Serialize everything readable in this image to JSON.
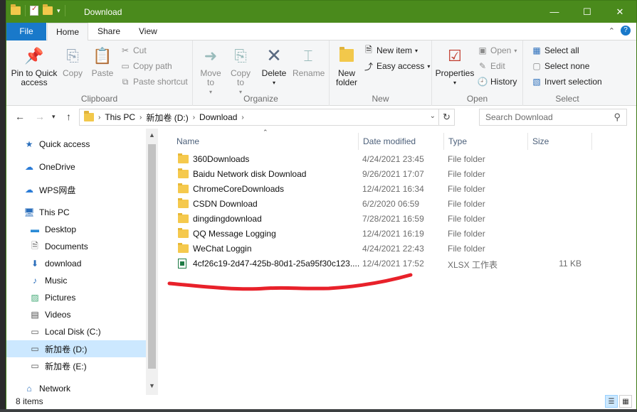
{
  "window": {
    "title": "Download"
  },
  "window_buttons": {
    "minimize": "—",
    "maximize": "☐",
    "close": "✕"
  },
  "tabs": [
    {
      "label": "File"
    },
    {
      "label": "Home"
    },
    {
      "label": "Share"
    },
    {
      "label": "View"
    }
  ],
  "ribbon": {
    "clipboard": {
      "label": "Clipboard",
      "pin": "Pin to Quick access",
      "copy": "Copy",
      "paste": "Paste",
      "cut": "Cut",
      "copy_path": "Copy path",
      "paste_shortcut": "Paste shortcut"
    },
    "organize": {
      "label": "Organize",
      "move_to": "Move to",
      "copy_to": "Copy to",
      "delete": "Delete",
      "rename": "Rename"
    },
    "new": {
      "label": "New",
      "new_folder": "New folder",
      "new_item": "New item",
      "easy_access": "Easy access"
    },
    "open": {
      "label": "Open",
      "properties": "Properties",
      "open": "Open",
      "edit": "Edit",
      "history": "History"
    },
    "select": {
      "label": "Select",
      "select_all": "Select all",
      "select_none": "Select none",
      "invert": "Invert selection"
    }
  },
  "address": {
    "crumbs": [
      "This PC",
      "新加卷 (D:)",
      "Download"
    ]
  },
  "search": {
    "placeholder": "Search Download"
  },
  "nav": [
    {
      "label": "Quick access",
      "icon": "star-icon"
    },
    {
      "label": "OneDrive",
      "icon": "cloud-icon"
    },
    {
      "label": "WPS网盘",
      "icon": "cloud-icon"
    },
    {
      "label": "This PC",
      "icon": "computer-icon"
    },
    {
      "label": "Desktop",
      "icon": "desktop-icon"
    },
    {
      "label": "Documents",
      "icon": "document-icon"
    },
    {
      "label": "download",
      "icon": "download-icon"
    },
    {
      "label": "Music",
      "icon": "music-icon"
    },
    {
      "label": "Pictures",
      "icon": "pictures-icon"
    },
    {
      "label": "Videos",
      "icon": "video-icon"
    },
    {
      "label": "Local Disk (C:)",
      "icon": "drive-icon"
    },
    {
      "label": "新加卷 (D:)",
      "icon": "drive-icon"
    },
    {
      "label": "新加卷 (E:)",
      "icon": "drive-icon"
    },
    {
      "label": "Network",
      "icon": "network-icon"
    }
  ],
  "columns": {
    "name": "Name",
    "date": "Date modified",
    "type": "Type",
    "size": "Size"
  },
  "files": [
    {
      "name": "360Downloads",
      "date": "4/24/2021 23:45",
      "type": "File folder",
      "size": ""
    },
    {
      "name": "Baidu Network disk Download",
      "date": "9/26/2021 17:07",
      "type": "File folder",
      "size": ""
    },
    {
      "name": "ChromeCoreDownloads",
      "date": "12/4/2021 16:34",
      "type": "File folder",
      "size": ""
    },
    {
      "name": "CSDN Download",
      "date": "6/2/2020 06:59",
      "type": "File folder",
      "size": ""
    },
    {
      "name": "dingdingdownload",
      "date": "7/28/2021 16:59",
      "type": "File folder",
      "size": ""
    },
    {
      "name": "QQ Message Logging",
      "date": "12/4/2021 16:19",
      "type": "File folder",
      "size": ""
    },
    {
      "name": "WeChat Loggin",
      "date": "4/24/2021 22:43",
      "type": "File folder",
      "size": ""
    },
    {
      "name": "4cf26c19-2d47-425b-80d1-25a95f30c123....",
      "date": "12/4/2021 17:52",
      "type": "XLSX 工作表",
      "size": "11 KB"
    }
  ],
  "status": {
    "count": "8 items"
  },
  "annotation": {
    "color": "#e8212a"
  }
}
